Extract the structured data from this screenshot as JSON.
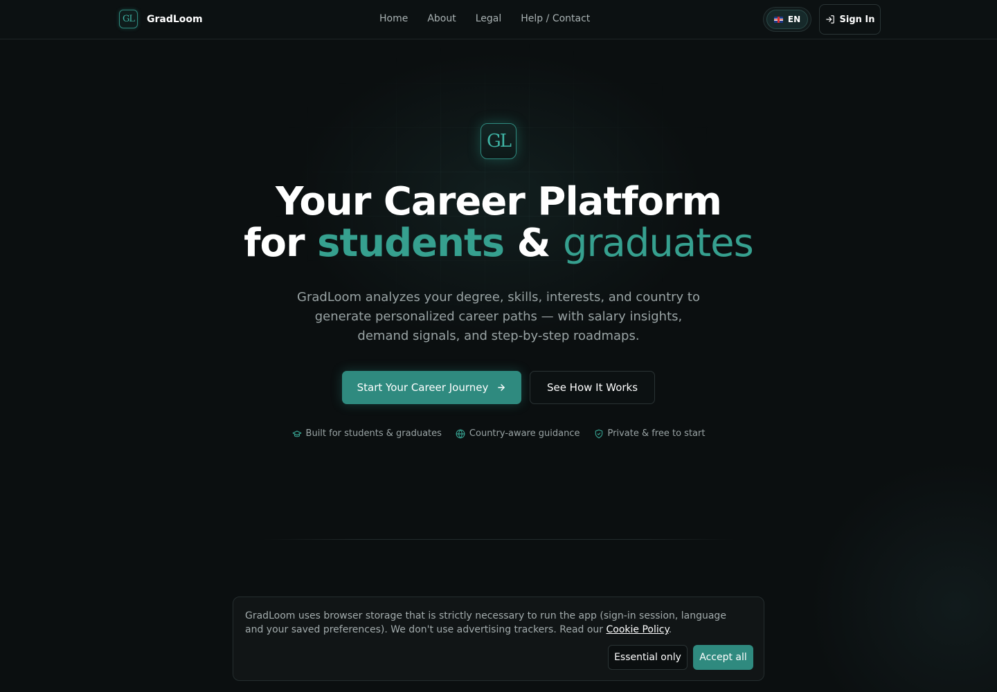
{
  "header": {
    "brand_mark": "GL",
    "brand_name": "GradLoom",
    "nav": [
      {
        "label": "Home"
      },
      {
        "label": "About"
      },
      {
        "label": "Legal"
      },
      {
        "label": "Help / Contact"
      }
    ],
    "language": {
      "label": "EN",
      "flag": "uk-flag-icon"
    },
    "signin_label": "Sign In"
  },
  "hero": {
    "logo_mark": "GL",
    "headline_line1": "Your Career Platform",
    "headline_for": "for",
    "headline_accent1": "students",
    "headline_amp": "&",
    "headline_accent2": "graduates",
    "subhead": "GradLoom analyzes your degree, skills, interests, and country to generate personalized career paths — with salary insights, demand signals, and step-by-step roadmaps.",
    "cta_primary": "Start Your Career Journey",
    "cta_secondary": "See How It Works",
    "badges": [
      {
        "label": "Built for students & graduates",
        "icon": "graduation-cap-icon"
      },
      {
        "label": "Country-aware guidance",
        "icon": "globe-icon"
      },
      {
        "label": "Private & free to start",
        "icon": "shield-check-icon"
      }
    ]
  },
  "cookie": {
    "text": "GradLoom uses browser storage that is strictly necessary to run the app (sign-in session, language and your saved preferences). We don't use advertising trackers. Read our",
    "link": "Cookie Policy",
    "period": ".",
    "essential_label": "Essential only",
    "accept_label": "Accept all"
  },
  "colors": {
    "accent": "#2f8a7f",
    "accent_text": "#36a08f",
    "background": "#0b0f10"
  }
}
